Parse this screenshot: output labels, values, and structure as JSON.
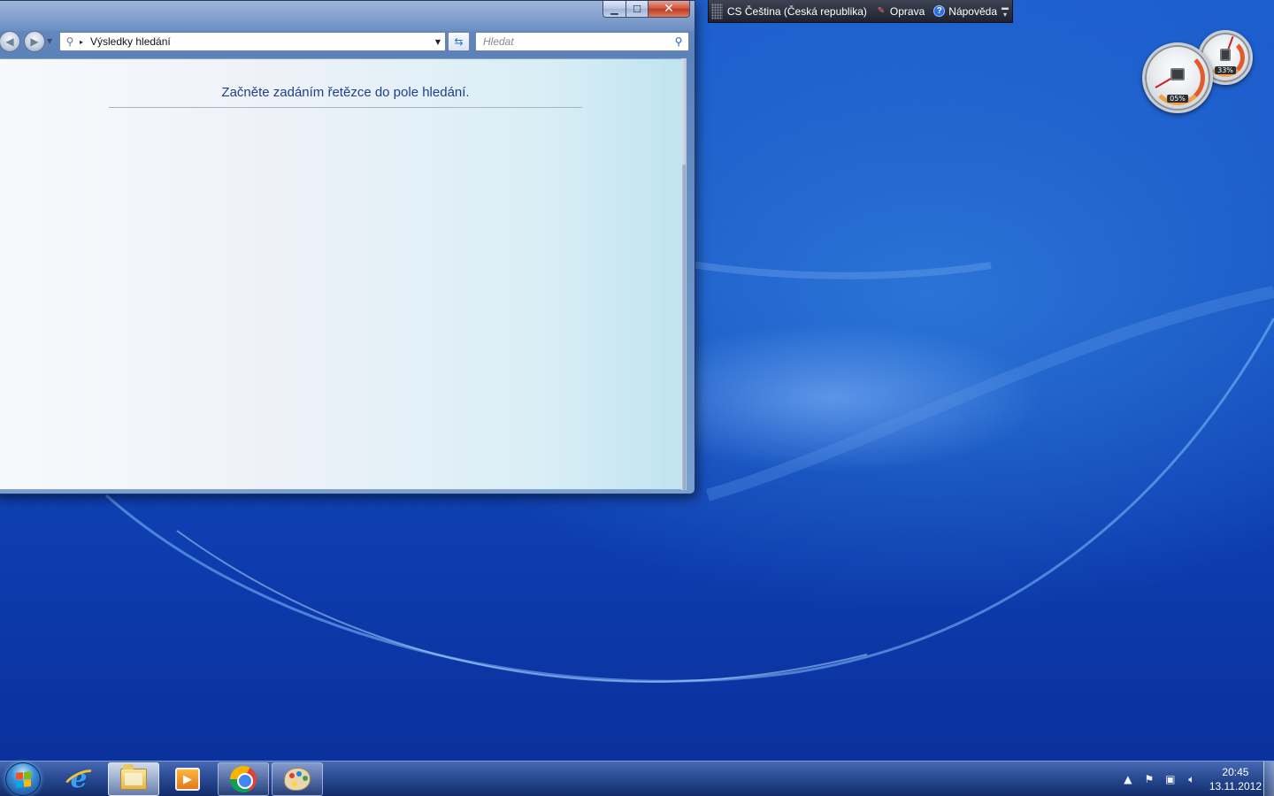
{
  "explorer": {
    "caption": {
      "minimize": "▁",
      "maximize": "☐",
      "close": "✕"
    },
    "address": {
      "separator": "▸",
      "path": "Výsledky hledání"
    },
    "search": {
      "placeholder": "Hledat"
    },
    "hint": "Začněte zadáním řetězce do pole hledání."
  },
  "langbar": {
    "language": "CS Čeština (Česká republika)",
    "repair": "Oprava",
    "help": "Nápověda"
  },
  "gadget": {
    "cpu": {
      "percent": "05%",
      "value": 0.05
    },
    "memory": {
      "percent": "33%",
      "value": 0.33
    }
  },
  "taskbar": {
    "apps": [
      {
        "name": "Internet Explorer",
        "state": "pinned"
      },
      {
        "name": "Windows Explorer",
        "state": "active"
      },
      {
        "name": "Windows Media Player",
        "state": "pinned"
      },
      {
        "name": "Google Chrome",
        "state": "open"
      },
      {
        "name": "Paint",
        "state": "open"
      }
    ],
    "clock": {
      "time": "20:45",
      "date": "13.11.2012"
    }
  },
  "colors": {
    "hint_text": "#1e3f8f",
    "desktop_blue": "#1551c4",
    "close_red": "#c03b22"
  }
}
